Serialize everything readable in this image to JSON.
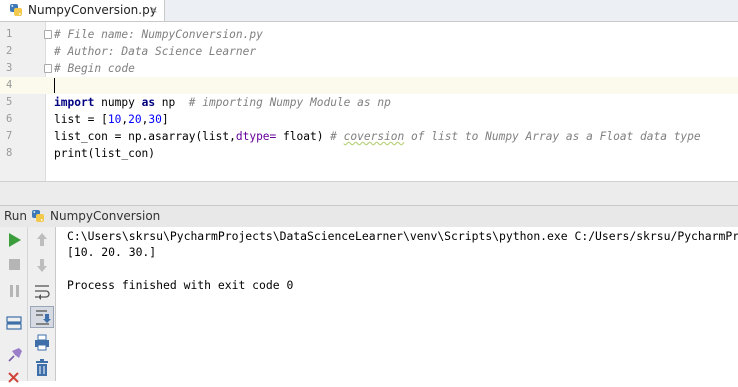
{
  "editor_tab": {
    "filename": "NumpyConversion.py",
    "close_glyph": "×"
  },
  "editor": {
    "line_numbers": [
      "1",
      "2",
      "3",
      "4",
      "5",
      "6",
      "7",
      "8"
    ],
    "lines": {
      "l1": "# File name: NumpyConversion.py",
      "l2": "# Author: Data Science Learner",
      "l3": "# Begin code",
      "l5_kw_import": "import",
      "l5_mid": " numpy ",
      "l5_kw_as": "as",
      "l5_alias": " np  ",
      "l5_comment": "# importing Numpy Module as np",
      "l6_prefix": "list = [",
      "l6_n1": "10",
      "l6_c1": ",",
      "l6_n2": "20",
      "l6_c2": ",",
      "l6_n3": "30",
      "l6_suffix": "]",
      "l7_prefix": "list_con = np.asarray(list,",
      "l7_param": "dtype=",
      "l7_mid": " float) ",
      "l7_comment_a": "# ",
      "l7_comment_warn": "coversion",
      "l7_comment_b": " of list to Numpy Array as a Float data type",
      "l8": "print(list_con)"
    }
  },
  "run_panel": {
    "label": "Run",
    "config_name": "NumpyConversion"
  },
  "console": {
    "command": "C:\\Users\\skrsu\\PycharmProjects\\DataScienceLearner\\venv\\Scripts\\python.exe C:/Users/skrsu/PycharmProjects/DataScienceLearner/NumpyConversion.py",
    "output": "[10. 20. 30.]",
    "exit_message": "Process finished with exit code 0"
  },
  "icons": {
    "toolbar_a": [
      "run-icon",
      "stop-icon",
      "pause-icon",
      "layout-icon",
      "pin-icon",
      "close-icon"
    ],
    "toolbar_b": [
      "up-arrow-icon",
      "down-arrow-icon",
      "soft-wrap-icon",
      "scroll-to-end-icon",
      "print-icon",
      "trash-icon"
    ]
  },
  "colors": {
    "run_green": "#3b9d3b",
    "comment_gray": "#808080",
    "keyword_navy": "#000080",
    "number_blue": "#0000ff",
    "param_purple": "#660099",
    "current_line": "#fcfaed"
  }
}
